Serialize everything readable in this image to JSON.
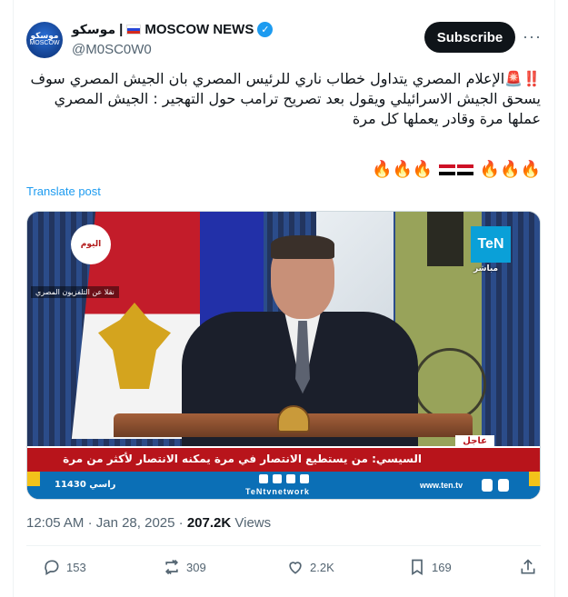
{
  "account": {
    "display_name_ar": "موسكو",
    "display_name_sep": "|",
    "display_name_en": "MOSCOW NEWS",
    "handle": "@M0SC0W0",
    "avatar_text_ar": "موسكو",
    "avatar_text_en": "MOSCOW"
  },
  "buttons": {
    "subscribe_label": "Subscribe",
    "more_label": "···"
  },
  "tweet": {
    "text": "‼️🚨الإعلام المصري يتداول خطاب ناري للرئيس المصري بان الجيش المصري سوف يسحق الجيش الاسرائيلي ويقول بعد تصريح ترامب حول التهجير  : الجيش المصري عملها مرة وقادر يعملها كل مرة",
    "fire_left": "🔥🔥🔥",
    "fire_right": "🔥🔥🔥",
    "translate_label": "Translate post"
  },
  "media": {
    "source_tag": "نقلا عن التلفزيون المصري",
    "channel_logo": "TeN",
    "live_label": "مباشر",
    "watermark_logo": "اليوم",
    "urgent_label": "عاجل",
    "headline": "السيسي: من يستطيع الانتصار في مرة يمكنه الانتصار لأكثر من مرة",
    "contact_number": "11430 راسي",
    "network_label": "TeNtvnetwork",
    "site_label": "www.ten.tv"
  },
  "meta": {
    "time": "12:05 AM",
    "dot": "·",
    "date": "Jan 28, 2025",
    "views_count": "207.2K",
    "views_label": "Views"
  },
  "actions": {
    "replies": "153",
    "reposts": "309",
    "likes": "2.2K",
    "bookmarks": "169"
  },
  "colors": {
    "accent": "#1d9bf0",
    "text_primary": "#0f1419",
    "text_secondary": "#536471",
    "ticker_red": "#b8141b",
    "ticker_blue": "#0b6fb6"
  }
}
